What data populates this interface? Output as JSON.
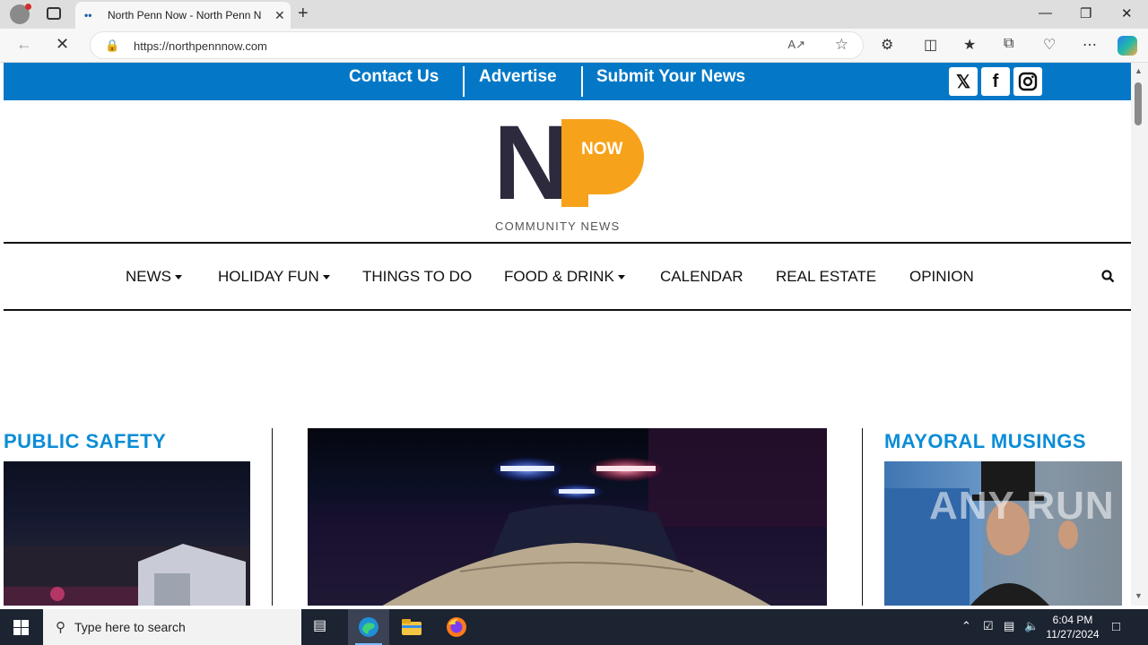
{
  "browser": {
    "tab_title": "North Penn Now - North Penn N",
    "url": "https://northpennnow.com"
  },
  "site": {
    "top_links": [
      "Contact Us",
      "Advertise",
      "Submit Your News"
    ],
    "social": [
      "x-icon",
      "facebook-icon",
      "instagram-icon"
    ],
    "logo": {
      "now": "NOW",
      "tagline": "COMMUNITY NEWS",
      "n_color": "#2d2a3e",
      "p_color": "#f7a21b"
    },
    "menu": [
      {
        "label": "NEWS",
        "dropdown": true
      },
      {
        "label": "HOLIDAY FUN",
        "dropdown": true
      },
      {
        "label": "THINGS TO DO",
        "dropdown": false
      },
      {
        "label": "FOOD & DRINK",
        "dropdown": true
      },
      {
        "label": "CALENDAR",
        "dropdown": false
      },
      {
        "label": "REAL ESTATE",
        "dropdown": false
      },
      {
        "label": "OPINION",
        "dropdown": false
      }
    ],
    "sections": {
      "left": "PUBLIC SAFETY",
      "right": "MAYORAL MUSINGS"
    },
    "accent": "#0478c7",
    "section_color": "#0b8dd6"
  },
  "watermark": "ANY RUN",
  "taskbar": {
    "search_placeholder": "Type here to search",
    "time": "6:04 PM",
    "date": "11/27/2024"
  }
}
